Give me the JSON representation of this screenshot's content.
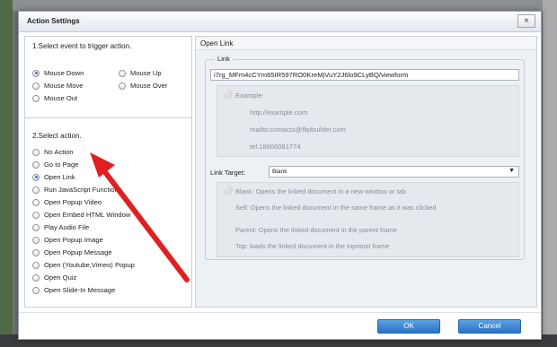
{
  "dialog": {
    "title": "Action Settings",
    "close_label": "×"
  },
  "trigger": {
    "heading": "1.Select event to trigger action.",
    "options": [
      {
        "label": "Mouse Down",
        "selected": true
      },
      {
        "label": "Mouse Up",
        "selected": false
      },
      {
        "label": "Mouse Move",
        "selected": false
      },
      {
        "label": "Mouse Over",
        "selected": false
      },
      {
        "label": "Mouse Out",
        "selected": false
      }
    ]
  },
  "action": {
    "heading": "2.Select action.",
    "options": [
      {
        "label": "No Action",
        "selected": false
      },
      {
        "label": "Go to Page",
        "selected": false
      },
      {
        "label": "Open Link",
        "selected": true
      },
      {
        "label": "Run JavaScript Function",
        "selected": false
      },
      {
        "label": "Open Popup Video",
        "selected": false
      },
      {
        "label": "Open Embed HTML Window",
        "selected": false
      },
      {
        "label": "Play Audio File",
        "selected": false
      },
      {
        "label": "Open Popup Image",
        "selected": false
      },
      {
        "label": "Open Popup Message",
        "selected": false
      },
      {
        "label": "Open (Youtube,Vimeo) Popup",
        "selected": false
      },
      {
        "label": "Open Quiz",
        "selected": false
      },
      {
        "label": "Open Slide-In Message",
        "selected": false
      }
    ]
  },
  "panel": {
    "title": "Open Link",
    "link_group_label": "Link",
    "link_value": "i7rg_MFm4cCYm65IR597RO0KreMjVuY2J6lo9CLyBQ/viewform",
    "example": {
      "label": "Example:",
      "lines": [
        "http://example.com",
        "mailto:contacts@flipbuilder.com",
        "tel:18666081774"
      ]
    },
    "target_label": "Link Target:",
    "target_value": "Blank",
    "descriptions": [
      "Blank: Opens the linked document in a new window or tab",
      "Self: Opens the linked document in the same frame as it was clicked",
      "Parent: Opens the linked document in the parent frame",
      "Top: loads the linked document in the topmost frame"
    ]
  },
  "buttons": {
    "ok": "OK",
    "cancel": "Cancel"
  },
  "colors": {
    "accent": "#3b73c8",
    "annotation_arrow": "#e02020"
  }
}
